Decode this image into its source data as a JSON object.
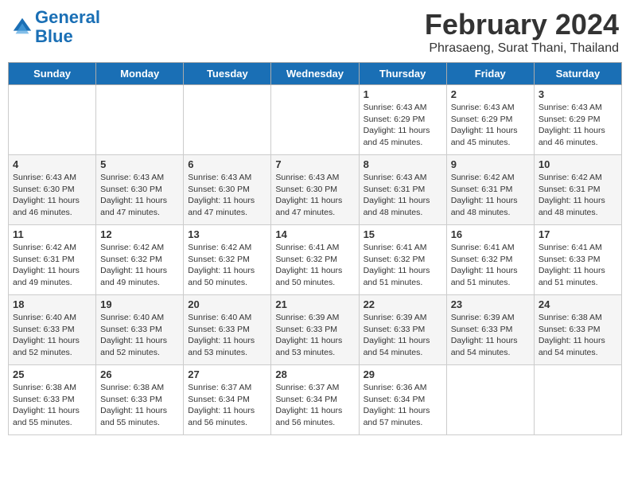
{
  "header": {
    "logo_line1": "General",
    "logo_line2": "Blue",
    "month_year": "February 2024",
    "location": "Phrasaeng, Surat Thani, Thailand"
  },
  "days_of_week": [
    "Sunday",
    "Monday",
    "Tuesday",
    "Wednesday",
    "Thursday",
    "Friday",
    "Saturday"
  ],
  "weeks": [
    [
      {
        "num": "",
        "sunrise": "",
        "sunset": "",
        "daylight": ""
      },
      {
        "num": "",
        "sunrise": "",
        "sunset": "",
        "daylight": ""
      },
      {
        "num": "",
        "sunrise": "",
        "sunset": "",
        "daylight": ""
      },
      {
        "num": "",
        "sunrise": "",
        "sunset": "",
        "daylight": ""
      },
      {
        "num": "1",
        "sunrise": "Sunrise: 6:43 AM",
        "sunset": "Sunset: 6:29 PM",
        "daylight": "Daylight: 11 hours and 45 minutes."
      },
      {
        "num": "2",
        "sunrise": "Sunrise: 6:43 AM",
        "sunset": "Sunset: 6:29 PM",
        "daylight": "Daylight: 11 hours and 45 minutes."
      },
      {
        "num": "3",
        "sunrise": "Sunrise: 6:43 AM",
        "sunset": "Sunset: 6:29 PM",
        "daylight": "Daylight: 11 hours and 46 minutes."
      }
    ],
    [
      {
        "num": "4",
        "sunrise": "Sunrise: 6:43 AM",
        "sunset": "Sunset: 6:30 PM",
        "daylight": "Daylight: 11 hours and 46 minutes."
      },
      {
        "num": "5",
        "sunrise": "Sunrise: 6:43 AM",
        "sunset": "Sunset: 6:30 PM",
        "daylight": "Daylight: 11 hours and 47 minutes."
      },
      {
        "num": "6",
        "sunrise": "Sunrise: 6:43 AM",
        "sunset": "Sunset: 6:30 PM",
        "daylight": "Daylight: 11 hours and 47 minutes."
      },
      {
        "num": "7",
        "sunrise": "Sunrise: 6:43 AM",
        "sunset": "Sunset: 6:30 PM",
        "daylight": "Daylight: 11 hours and 47 minutes."
      },
      {
        "num": "8",
        "sunrise": "Sunrise: 6:43 AM",
        "sunset": "Sunset: 6:31 PM",
        "daylight": "Daylight: 11 hours and 48 minutes."
      },
      {
        "num": "9",
        "sunrise": "Sunrise: 6:42 AM",
        "sunset": "Sunset: 6:31 PM",
        "daylight": "Daylight: 11 hours and 48 minutes."
      },
      {
        "num": "10",
        "sunrise": "Sunrise: 6:42 AM",
        "sunset": "Sunset: 6:31 PM",
        "daylight": "Daylight: 11 hours and 48 minutes."
      }
    ],
    [
      {
        "num": "11",
        "sunrise": "Sunrise: 6:42 AM",
        "sunset": "Sunset: 6:31 PM",
        "daylight": "Daylight: 11 hours and 49 minutes."
      },
      {
        "num": "12",
        "sunrise": "Sunrise: 6:42 AM",
        "sunset": "Sunset: 6:32 PM",
        "daylight": "Daylight: 11 hours and 49 minutes."
      },
      {
        "num": "13",
        "sunrise": "Sunrise: 6:42 AM",
        "sunset": "Sunset: 6:32 PM",
        "daylight": "Daylight: 11 hours and 50 minutes."
      },
      {
        "num": "14",
        "sunrise": "Sunrise: 6:41 AM",
        "sunset": "Sunset: 6:32 PM",
        "daylight": "Daylight: 11 hours and 50 minutes."
      },
      {
        "num": "15",
        "sunrise": "Sunrise: 6:41 AM",
        "sunset": "Sunset: 6:32 PM",
        "daylight": "Daylight: 11 hours and 51 minutes."
      },
      {
        "num": "16",
        "sunrise": "Sunrise: 6:41 AM",
        "sunset": "Sunset: 6:32 PM",
        "daylight": "Daylight: 11 hours and 51 minutes."
      },
      {
        "num": "17",
        "sunrise": "Sunrise: 6:41 AM",
        "sunset": "Sunset: 6:33 PM",
        "daylight": "Daylight: 11 hours and 51 minutes."
      }
    ],
    [
      {
        "num": "18",
        "sunrise": "Sunrise: 6:40 AM",
        "sunset": "Sunset: 6:33 PM",
        "daylight": "Daylight: 11 hours and 52 minutes."
      },
      {
        "num": "19",
        "sunrise": "Sunrise: 6:40 AM",
        "sunset": "Sunset: 6:33 PM",
        "daylight": "Daylight: 11 hours and 52 minutes."
      },
      {
        "num": "20",
        "sunrise": "Sunrise: 6:40 AM",
        "sunset": "Sunset: 6:33 PM",
        "daylight": "Daylight: 11 hours and 53 minutes."
      },
      {
        "num": "21",
        "sunrise": "Sunrise: 6:39 AM",
        "sunset": "Sunset: 6:33 PM",
        "daylight": "Daylight: 11 hours and 53 minutes."
      },
      {
        "num": "22",
        "sunrise": "Sunrise: 6:39 AM",
        "sunset": "Sunset: 6:33 PM",
        "daylight": "Daylight: 11 hours and 54 minutes."
      },
      {
        "num": "23",
        "sunrise": "Sunrise: 6:39 AM",
        "sunset": "Sunset: 6:33 PM",
        "daylight": "Daylight: 11 hours and 54 minutes."
      },
      {
        "num": "24",
        "sunrise": "Sunrise: 6:38 AM",
        "sunset": "Sunset: 6:33 PM",
        "daylight": "Daylight: 11 hours and 54 minutes."
      }
    ],
    [
      {
        "num": "25",
        "sunrise": "Sunrise: 6:38 AM",
        "sunset": "Sunset: 6:33 PM",
        "daylight": "Daylight: 11 hours and 55 minutes."
      },
      {
        "num": "26",
        "sunrise": "Sunrise: 6:38 AM",
        "sunset": "Sunset: 6:33 PM",
        "daylight": "Daylight: 11 hours and 55 minutes."
      },
      {
        "num": "27",
        "sunrise": "Sunrise: 6:37 AM",
        "sunset": "Sunset: 6:34 PM",
        "daylight": "Daylight: 11 hours and 56 minutes."
      },
      {
        "num": "28",
        "sunrise": "Sunrise: 6:37 AM",
        "sunset": "Sunset: 6:34 PM",
        "daylight": "Daylight: 11 hours and 56 minutes."
      },
      {
        "num": "29",
        "sunrise": "Sunrise: 6:36 AM",
        "sunset": "Sunset: 6:34 PM",
        "daylight": "Daylight: 11 hours and 57 minutes."
      },
      {
        "num": "",
        "sunrise": "",
        "sunset": "",
        "daylight": ""
      },
      {
        "num": "",
        "sunrise": "",
        "sunset": "",
        "daylight": ""
      }
    ]
  ]
}
